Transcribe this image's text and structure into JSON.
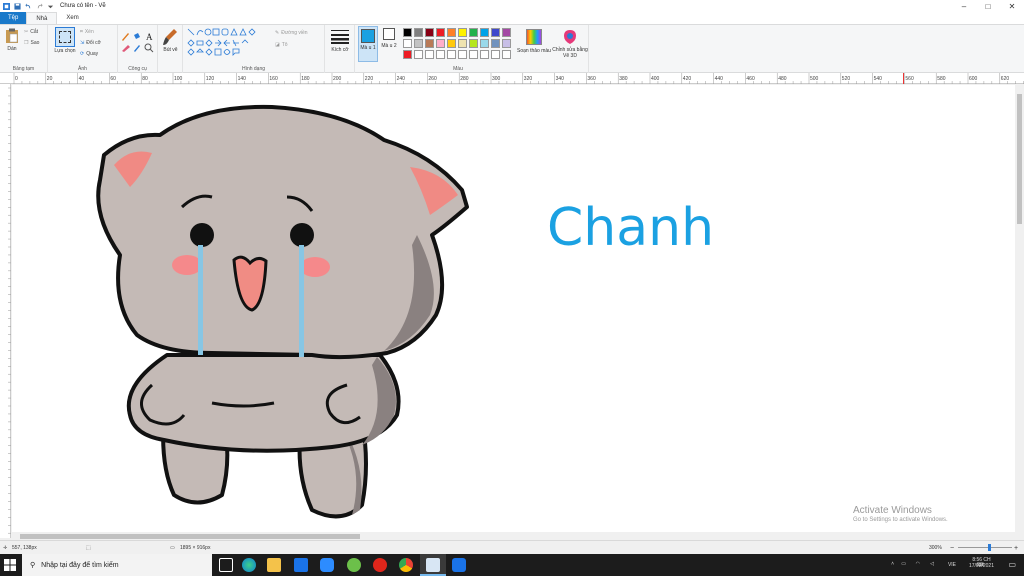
{
  "window": {
    "title": "Chưa có tên - Vẽ"
  },
  "tabs": [
    "Tệp",
    "Nhà",
    "Xem"
  ],
  "ribbon": {
    "clipboard": {
      "paste": "Dán",
      "cut": "Cắt",
      "copy": "Sao",
      "label": "Bảng tạm"
    },
    "image": {
      "select": "Lựa chọn",
      "crop": "Xén",
      "resize": "Đổi cỡ",
      "rotate": "Quay",
      "label": "Ảnh"
    },
    "tools": {
      "label": "Công cụ"
    },
    "brushes": {
      "label": "Bút vẽ"
    },
    "shapes": {
      "outline": "Đường viền",
      "fill": "Tô",
      "label": "Hình dạng"
    },
    "size": {
      "label": "Kích cỡ"
    },
    "color1": {
      "label": "Mà u 1"
    },
    "color2": {
      "label": "Mà u 2"
    },
    "colors_label": "Màu",
    "edit_colors": "Soạn thảo màu",
    "paint3d": "Chỉnh sửa bằng Vẽ 3D"
  },
  "palette": {
    "color1": "#1ba1e2",
    "color2": "#ffffff",
    "row1": [
      "#000000",
      "#7f7f7f",
      "#880015",
      "#ed1c24",
      "#ff7f27",
      "#fff200",
      "#22b14c",
      "#00a2e8",
      "#3f48cc",
      "#a349a4"
    ],
    "row2": [
      "#ffffff",
      "#c3c3c3",
      "#b97a57",
      "#ffaec9",
      "#ffc90e",
      "#efe4b0",
      "#b5e61d",
      "#99d9ea",
      "#7092be",
      "#c8bfe7"
    ],
    "row3": [
      "#ed1c24",
      "#ffffff",
      "#ffffff",
      "#ffffff",
      "#ffffff",
      "#ffffff",
      "#ffffff",
      "#ffffff",
      "#ffffff",
      "#ffffff"
    ]
  },
  "ruler_labels": [
    "0",
    "20",
    "40",
    "60",
    "80",
    "100",
    "120",
    "140",
    "160",
    "180",
    "200",
    "220",
    "240",
    "260",
    "280",
    "300",
    "320",
    "340",
    "360",
    "380",
    "400",
    "420",
    "440",
    "460",
    "480",
    "500",
    "520",
    "540",
    "560",
    "580",
    "600",
    "620"
  ],
  "canvas": {
    "text": "Chanh",
    "text_color": "#1ba1e2"
  },
  "status": {
    "cursor": "557, 138px",
    "size": "1895 × 916px",
    "zoom": "300%"
  },
  "watermark": {
    "line1": "Activate Windows",
    "line2": "Go to Settings to activate Windows."
  },
  "taskbar": {
    "search_placeholder": "Nhập tại đây để tìm kiếm",
    "time": "8:56 CH",
    "date": "17/02/2021",
    "lang": "VIE"
  }
}
